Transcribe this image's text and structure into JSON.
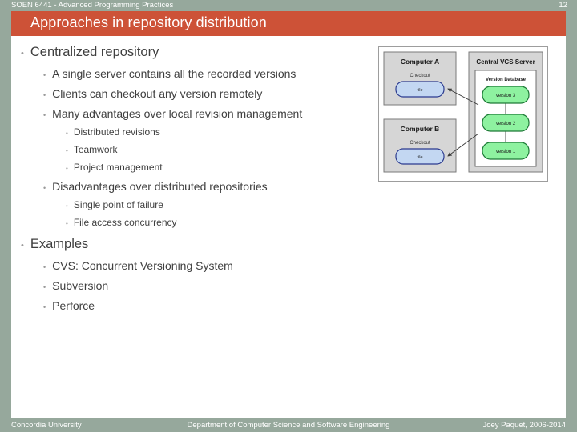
{
  "header": {
    "course": "SOEN 6441 - Advanced Programming Practices",
    "page_number": "12",
    "bar_color": "#96a89c"
  },
  "title": {
    "text": "Approaches in repository distribution",
    "bar_color": "#cd5237",
    "text_color": "#ffffff"
  },
  "bullets": [
    {
      "level": 1,
      "text": "Centralized repository"
    },
    {
      "level": 2,
      "text": "A single server contains all the recorded versions"
    },
    {
      "level": 2,
      "text": "Clients can checkout any version remotely"
    },
    {
      "level": 2,
      "text": "Many advantages over local revision management"
    },
    {
      "level": 3,
      "text": "Distributed revisions"
    },
    {
      "level": 3,
      "text": "Teamwork"
    },
    {
      "level": 3,
      "text": "Project management"
    },
    {
      "level": 2,
      "text": "Disadvantages over distributed repositories"
    },
    {
      "level": 3,
      "text": "Single point of failure"
    },
    {
      "level": 3,
      "text": "File access concurrency"
    },
    {
      "level": 1,
      "text": "Examples"
    },
    {
      "level": 2,
      "text": "CVS: Concurrent Versioning System"
    },
    {
      "level": 2,
      "text": "Subversion"
    },
    {
      "level": 2,
      "text": "Perforce"
    }
  ],
  "diagram": {
    "alt_name": "centralized-version-control-diagram",
    "computer_a": {
      "title": "Computer A",
      "checkout_label": "Checkout",
      "file_label": "file"
    },
    "computer_b": {
      "title": "Computer B",
      "checkout_label": "Checkout",
      "file_label": "file"
    },
    "server": {
      "title": "Central VCS Server",
      "database_label": "Version Database",
      "versions": [
        "version 3",
        "version 2",
        "version 1"
      ]
    },
    "colors": {
      "computer_box_fill": "#d6d6d6",
      "file_fill": "#c3d7f2",
      "file_stroke": "#2b3a8f",
      "version_fill": "#8ef2a0",
      "version_stroke": "#1d7a36",
      "server_fill": "#d6d6d6",
      "database_fill": "#ffffff"
    }
  },
  "footer": {
    "left": "Concordia University",
    "center": "Department of Computer Science and Software Engineering",
    "right": "Joey Paquet, 2006-2014",
    "bar_color": "#96a89c"
  }
}
